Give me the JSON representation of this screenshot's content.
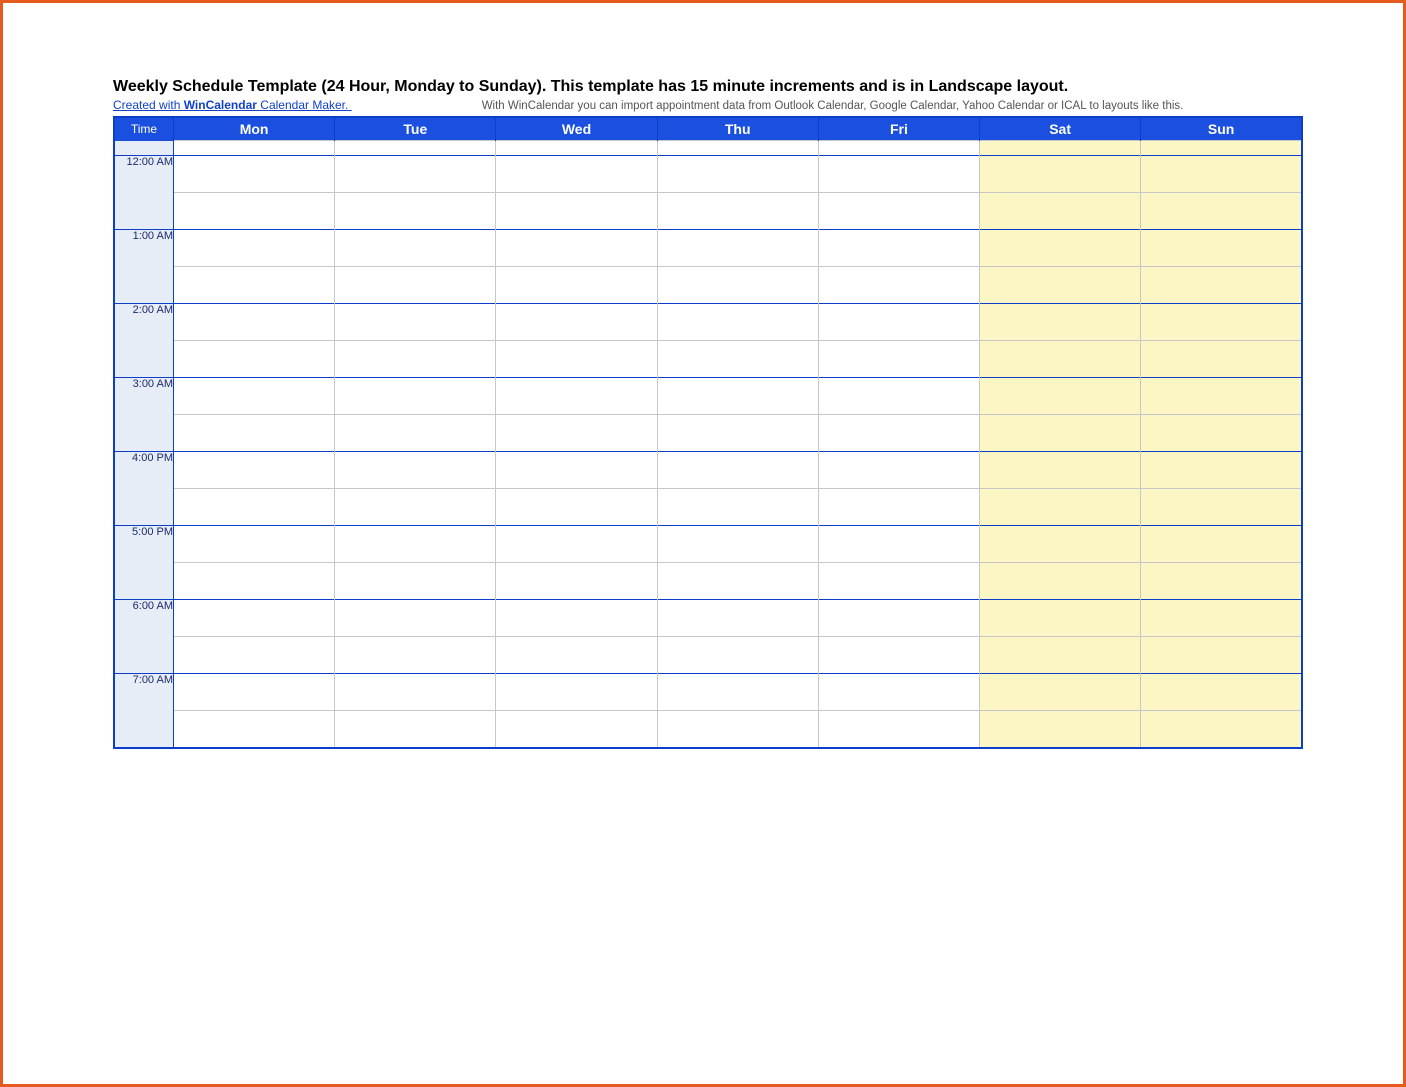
{
  "title": "Weekly Schedule Template (24 Hour, Monday to Sunday).  This template has 15 minute increments and is in Landscape layout.",
  "maker_link": {
    "prefix": "Created with ",
    "brand": "WinCalendar",
    "suffix": " Calendar Maker."
  },
  "import_note": "With WinCalendar you can import appointment data from Outlook Calendar, Google Calendar, Yahoo Calendar or ICAL to layouts like this.",
  "columns": {
    "time": "Time",
    "days": [
      "Mon",
      "Tue",
      "Wed",
      "Thu",
      "Fri",
      "Sat",
      "Sun"
    ]
  },
  "weekend_days": [
    "Sat",
    "Sun"
  ],
  "time_slots": [
    "12:00 AM",
    "1:00 AM",
    "2:00 AM",
    "3:00 AM",
    "4:00 PM",
    "5:00 PM",
    "6:00 AM",
    "7:00 AM"
  ],
  "sub_rows_per_hour": 2
}
